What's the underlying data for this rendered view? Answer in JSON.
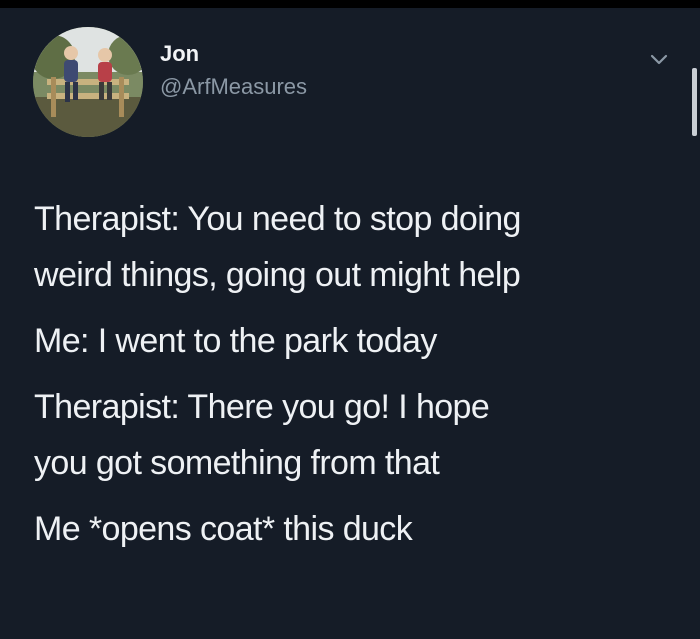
{
  "tweet": {
    "author_name": "Jon",
    "author_handle": "@ArfMeasures",
    "avatar_icon": "profile-photo",
    "menu_icon": "chevron-down-icon",
    "paragraphs": [
      {
        "line1": "Therapist: You need to stop doing",
        "line2": "weird things, going out might help"
      },
      {
        "line1": "Me: I went to the park today",
        "line2": ""
      },
      {
        "line1": "Therapist: There you go! I hope",
        "line2": "you got something from that"
      },
      {
        "line1": "Me *opens coat* this duck",
        "line2": ""
      }
    ]
  },
  "colors": {
    "background": "#151c27",
    "text": "#eef1f4",
    "handle": "#8b98a5"
  }
}
